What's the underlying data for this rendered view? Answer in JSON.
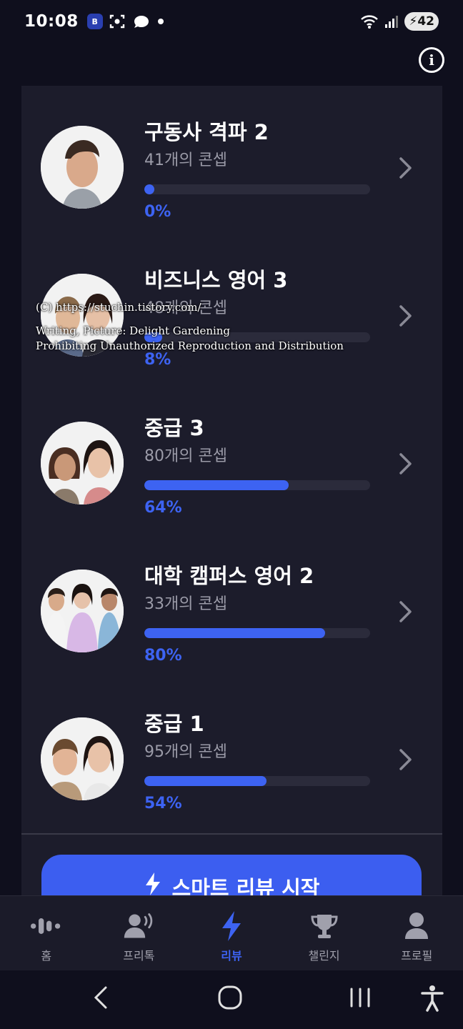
{
  "status_bar": {
    "time": "10:08",
    "battery": "42",
    "app_badge_text": "B"
  },
  "courses": [
    {
      "title": "구동사 격파 2",
      "subtitle": "41개의 콘셉",
      "progress_label": "0%",
      "progress": 0.0
    },
    {
      "title": "비즈니스 영어 3",
      "subtitle": "48개의 콘셉",
      "progress_label": "8%",
      "progress": 0.08
    },
    {
      "title": "중급 3",
      "subtitle": "80개의 콘셉",
      "progress_label": "64%",
      "progress": 0.64
    },
    {
      "title": "대학 캠퍼스 영어 2",
      "subtitle": "33개의 콘셉",
      "progress_label": "80%",
      "progress": 0.8
    },
    {
      "title": "중급 1",
      "subtitle": "95개의 콘셉",
      "progress_label": "54%",
      "progress": 0.54
    }
  ],
  "watermark": {
    "line1": "(C) https://stuchin.tistory.com/",
    "line2": "Writing, Picture: Delight Gardening",
    "line3": "Prohibiting Unauthorized Reproduction and Distribution"
  },
  "review_button": {
    "label": "스마트 리뷰 시작"
  },
  "bottom_nav": [
    {
      "label": "홈",
      "icon": "voice-wave-icon",
      "active": false
    },
    {
      "label": "프리톡",
      "icon": "speaking-person-icon",
      "active": false
    },
    {
      "label": "리뷰",
      "icon": "lightning-icon",
      "active": true
    },
    {
      "label": "챌린지",
      "icon": "trophy-icon",
      "active": false
    },
    {
      "label": "프로필",
      "icon": "person-icon",
      "active": false
    }
  ],
  "colors": {
    "accent": "#3d63f2",
    "background": "#0f0f1d",
    "panel": "#1c1c2b",
    "track": "#2b2b3b",
    "muted_text": "#9b9ba8"
  }
}
